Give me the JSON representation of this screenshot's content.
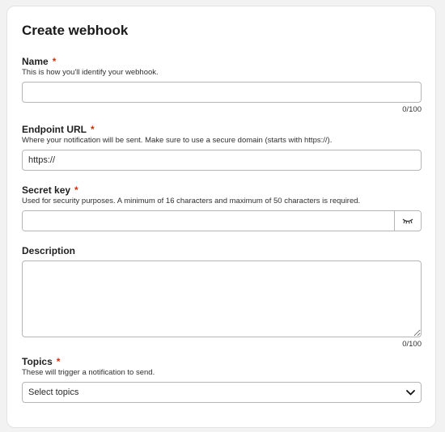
{
  "title": "Create webhook",
  "name_field": {
    "label": "Name",
    "required_mark": "*",
    "help": "This is how you'll identify your webhook.",
    "value": "",
    "counter": "0/100"
  },
  "endpoint_field": {
    "label": "Endpoint URL",
    "required_mark": "*",
    "help": "Where your notification will be sent. Make sure to use a secure domain (starts with https://).",
    "value": "https://"
  },
  "secret_field": {
    "label": "Secret key",
    "required_mark": "*",
    "help": "Used for security purposes. A minimum of 16 characters and maximum of 50 characters is required.",
    "value": "",
    "toggle_icon": "eye-closed-icon"
  },
  "description_field": {
    "label": "Description",
    "value": "",
    "counter": "0/100"
  },
  "topics_field": {
    "label": "Topics",
    "required_mark": "*",
    "help": "These will trigger a notification to send.",
    "selected": "Select topics",
    "chevron_icon": "chevron-down-icon"
  },
  "colors": {
    "required": "#d72c0d",
    "border": "#b5b5b8"
  }
}
